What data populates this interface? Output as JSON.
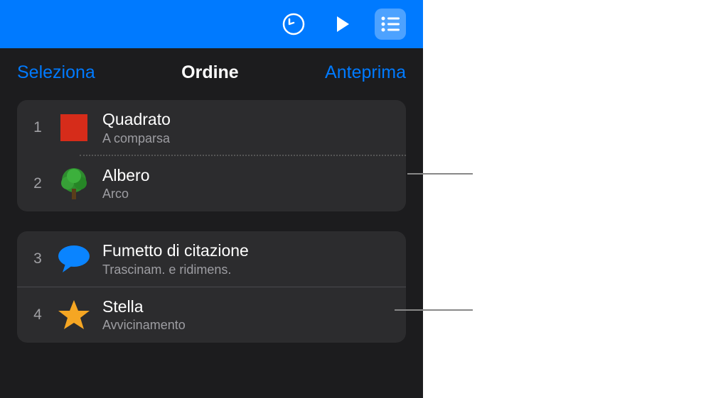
{
  "tabs": {
    "select": "Seleziona",
    "order": "Ordine",
    "preview": "Anteprima"
  },
  "items": {
    "g1": [
      {
        "num": "1",
        "title": "Quadrato",
        "subtitle": "A comparsa"
      },
      {
        "num": "2",
        "title": "Albero",
        "subtitle": "Arco"
      }
    ],
    "g2": [
      {
        "num": "3",
        "title": "Fumetto di citazione",
        "subtitle": "Trascinam. e ridimens."
      },
      {
        "num": "4",
        "title": "Stella",
        "subtitle": "Avvicinamento"
      }
    ]
  }
}
